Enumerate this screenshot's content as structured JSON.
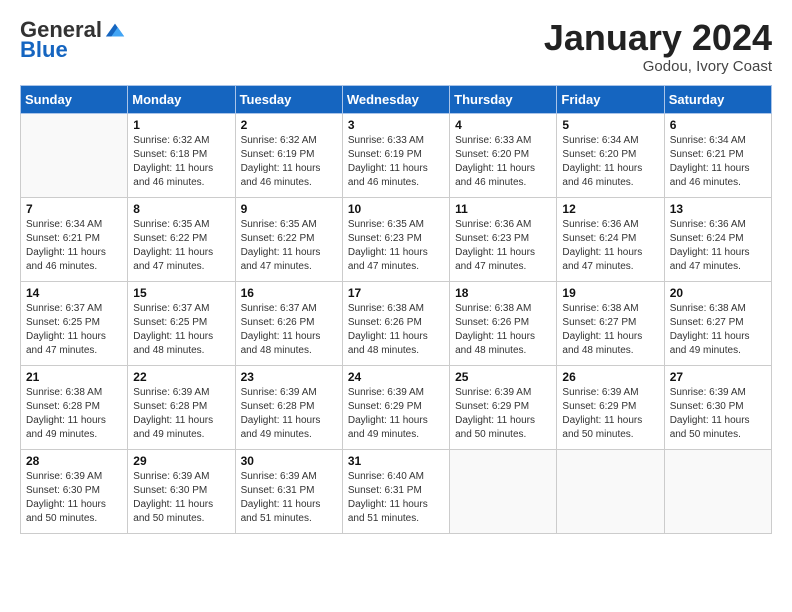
{
  "logo": {
    "general": "General",
    "blue": "Blue"
  },
  "title": "January 2024",
  "location": "Godou, Ivory Coast",
  "days_header": [
    "Sunday",
    "Monday",
    "Tuesday",
    "Wednesday",
    "Thursday",
    "Friday",
    "Saturday"
  ],
  "weeks": [
    [
      {
        "day": "",
        "info": ""
      },
      {
        "day": "1",
        "info": "Sunrise: 6:32 AM\nSunset: 6:18 PM\nDaylight: 11 hours and 46 minutes."
      },
      {
        "day": "2",
        "info": "Sunrise: 6:32 AM\nSunset: 6:19 PM\nDaylight: 11 hours and 46 minutes."
      },
      {
        "day": "3",
        "info": "Sunrise: 6:33 AM\nSunset: 6:19 PM\nDaylight: 11 hours and 46 minutes."
      },
      {
        "day": "4",
        "info": "Sunrise: 6:33 AM\nSunset: 6:20 PM\nDaylight: 11 hours and 46 minutes."
      },
      {
        "day": "5",
        "info": "Sunrise: 6:34 AM\nSunset: 6:20 PM\nDaylight: 11 hours and 46 minutes."
      },
      {
        "day": "6",
        "info": "Sunrise: 6:34 AM\nSunset: 6:21 PM\nDaylight: 11 hours and 46 minutes."
      }
    ],
    [
      {
        "day": "7",
        "info": "Sunrise: 6:34 AM\nSunset: 6:21 PM\nDaylight: 11 hours and 46 minutes."
      },
      {
        "day": "8",
        "info": "Sunrise: 6:35 AM\nSunset: 6:22 PM\nDaylight: 11 hours and 47 minutes."
      },
      {
        "day": "9",
        "info": "Sunrise: 6:35 AM\nSunset: 6:22 PM\nDaylight: 11 hours and 47 minutes."
      },
      {
        "day": "10",
        "info": "Sunrise: 6:35 AM\nSunset: 6:23 PM\nDaylight: 11 hours and 47 minutes."
      },
      {
        "day": "11",
        "info": "Sunrise: 6:36 AM\nSunset: 6:23 PM\nDaylight: 11 hours and 47 minutes."
      },
      {
        "day": "12",
        "info": "Sunrise: 6:36 AM\nSunset: 6:24 PM\nDaylight: 11 hours and 47 minutes."
      },
      {
        "day": "13",
        "info": "Sunrise: 6:36 AM\nSunset: 6:24 PM\nDaylight: 11 hours and 47 minutes."
      }
    ],
    [
      {
        "day": "14",
        "info": "Sunrise: 6:37 AM\nSunset: 6:25 PM\nDaylight: 11 hours and 47 minutes."
      },
      {
        "day": "15",
        "info": "Sunrise: 6:37 AM\nSunset: 6:25 PM\nDaylight: 11 hours and 48 minutes."
      },
      {
        "day": "16",
        "info": "Sunrise: 6:37 AM\nSunset: 6:26 PM\nDaylight: 11 hours and 48 minutes."
      },
      {
        "day": "17",
        "info": "Sunrise: 6:38 AM\nSunset: 6:26 PM\nDaylight: 11 hours and 48 minutes."
      },
      {
        "day": "18",
        "info": "Sunrise: 6:38 AM\nSunset: 6:26 PM\nDaylight: 11 hours and 48 minutes."
      },
      {
        "day": "19",
        "info": "Sunrise: 6:38 AM\nSunset: 6:27 PM\nDaylight: 11 hours and 48 minutes."
      },
      {
        "day": "20",
        "info": "Sunrise: 6:38 AM\nSunset: 6:27 PM\nDaylight: 11 hours and 49 minutes."
      }
    ],
    [
      {
        "day": "21",
        "info": "Sunrise: 6:38 AM\nSunset: 6:28 PM\nDaylight: 11 hours and 49 minutes."
      },
      {
        "day": "22",
        "info": "Sunrise: 6:39 AM\nSunset: 6:28 PM\nDaylight: 11 hours and 49 minutes."
      },
      {
        "day": "23",
        "info": "Sunrise: 6:39 AM\nSunset: 6:28 PM\nDaylight: 11 hours and 49 minutes."
      },
      {
        "day": "24",
        "info": "Sunrise: 6:39 AM\nSunset: 6:29 PM\nDaylight: 11 hours and 49 minutes."
      },
      {
        "day": "25",
        "info": "Sunrise: 6:39 AM\nSunset: 6:29 PM\nDaylight: 11 hours and 50 minutes."
      },
      {
        "day": "26",
        "info": "Sunrise: 6:39 AM\nSunset: 6:29 PM\nDaylight: 11 hours and 50 minutes."
      },
      {
        "day": "27",
        "info": "Sunrise: 6:39 AM\nSunset: 6:30 PM\nDaylight: 11 hours and 50 minutes."
      }
    ],
    [
      {
        "day": "28",
        "info": "Sunrise: 6:39 AM\nSunset: 6:30 PM\nDaylight: 11 hours and 50 minutes."
      },
      {
        "day": "29",
        "info": "Sunrise: 6:39 AM\nSunset: 6:30 PM\nDaylight: 11 hours and 50 minutes."
      },
      {
        "day": "30",
        "info": "Sunrise: 6:39 AM\nSunset: 6:31 PM\nDaylight: 11 hours and 51 minutes."
      },
      {
        "day": "31",
        "info": "Sunrise: 6:40 AM\nSunset: 6:31 PM\nDaylight: 11 hours and 51 minutes."
      },
      {
        "day": "",
        "info": ""
      },
      {
        "day": "",
        "info": ""
      },
      {
        "day": "",
        "info": ""
      }
    ]
  ]
}
